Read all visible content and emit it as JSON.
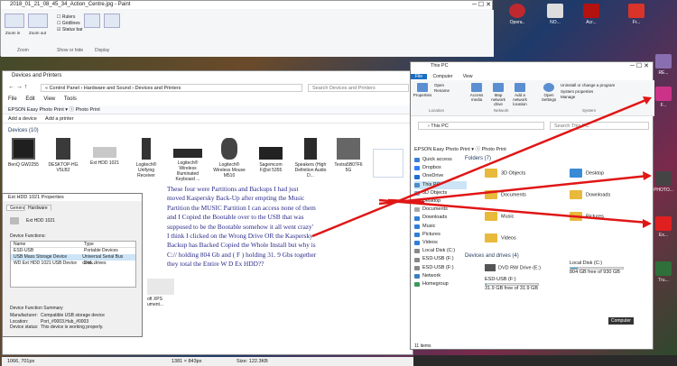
{
  "paint": {
    "title": "2018_01_21_08_45_34_Action_Centre.jpg - Paint",
    "checks": [
      "Rulers",
      "Gridlines",
      "Status bar"
    ],
    "buttons": [
      "Zoom in",
      "Zoom out",
      "100%",
      "Full screen",
      "Thumbnail"
    ],
    "groups": [
      "Zoom",
      "Show or hide",
      "Display"
    ],
    "status": {
      "coords": "1066, 701px",
      "dimensions": "1381 × 843px",
      "size": "Size: 122.3KB"
    }
  },
  "dap": {
    "title": "Devices and Printers",
    "address": "« Control Panel › Hardware and Sound › Devices and Printers",
    "search_placeholder": "Search Devices and Printers",
    "menu": [
      "File",
      "Edit",
      "View",
      "Tools"
    ],
    "app_bar": "EPSON  Easy Photo Print  ▾  ⓘ Photo Print",
    "commands": [
      "Add a device",
      "Add a printer"
    ],
    "section_title": "Devices (10)",
    "devices": [
      {
        "label": "BenQ GW2255",
        "icon": "monitor-icon"
      },
      {
        "label": "DESKTOP-HG V5LB2",
        "icon": "computer-tower-icon"
      },
      {
        "label": "Ext HDD 1021",
        "icon": "external-drive-icon"
      },
      {
        "label": "Logitech® Unifying Receiver",
        "icon": "usb-receiver-icon"
      },
      {
        "label": "Logitech® Wireless Illuminated Keyboard ...",
        "icon": "keyboard-icon"
      },
      {
        "label": "Logitech® Wireless Mouse M510",
        "icon": "mouse-icon"
      },
      {
        "label": "Sagemcom F@st 5355",
        "icon": "router-icon"
      },
      {
        "label": "Speakers (High Definition Audio D...",
        "icon": "speaker-icon"
      },
      {
        "label": "Textra5B07F6 5G",
        "icon": "hotspot-icon"
      }
    ],
    "partial_label": "oft XPS ument..."
  },
  "props": {
    "title": "Ext HDD 1021 Properties",
    "tabs": [
      "General",
      "Hardware"
    ],
    "device_name": "Ext HDD 1021",
    "functions_label": "Device Functions:",
    "columns": [
      "Name",
      "Type"
    ],
    "rows": [
      [
        "ESD-USB",
        "Portable Devices"
      ],
      [
        "USB Mass Storage Device",
        "Universal Serial Bus cont..."
      ],
      [
        "WD Ext HDD 1021 USB Device",
        "Disk drives"
      ]
    ],
    "summary_label": "Device Function Summary",
    "summary": [
      [
        "Manufacturer:",
        "Compatible USB storage device"
      ],
      [
        "Location:",
        "Port_#0003.Hub_#0003"
      ],
      [
        "Device status:",
        "This device is working properly."
      ]
    ]
  },
  "note": "These four were Partitions and Backups I had just moved Kaspersky Back-Up after empting the Music Partition the MUSIC Partition  I can access none of them and I Copied the Bootable over to the USB that was supposed to be the Bootable somehow it all went crazy' I think I clicked on the Wrong Drive OR the Kaspersky  Backup has Backed Copied the Whole  Install but why is C:// holding 804 Gb and ( F ) holding 31. 9 Gbs together they total the Entire W D Ex HDD??",
  "pc": {
    "title": "This PC",
    "tabs": [
      "File",
      "Computer",
      "View"
    ],
    "ribbon": [
      "Properties",
      "Open",
      "Rename",
      "Access media",
      "Map network drive",
      "Add a network location",
      "Open Settings",
      "Uninstall or change a program",
      "System properties",
      "Manage"
    ],
    "ribbon_groups": [
      "Location",
      "Network",
      "System"
    ],
    "address": "› This PC",
    "search_placeholder": "Search This PC",
    "app_bar": "EPSON  Easy Photo Print  ▾  ⓘ Photo Print",
    "nav": [
      "Quick access",
      "Dropbox",
      "OneDrive",
      "This PC",
      "3D Objects",
      "Desktop",
      "Documents",
      "Downloads",
      "Music",
      "Pictures",
      "Videos",
      "Local Disk (C:)",
      "ESD-USB (F:)",
      "ESD-USB (F:)",
      "Network",
      "Homegroup"
    ],
    "folders_title": "Folders (7)",
    "folders": [
      "3D Objects",
      "Desktop",
      "Documents",
      "Downloads",
      "Music",
      "Pictures",
      "Videos"
    ],
    "drives_title": "Devices and drives (4)",
    "drives": [
      {
        "name": "DVD RW Drive (E:)",
        "detail": "",
        "fill": 0
      },
      {
        "name": "Local Disk (C:)",
        "detail": "804 GB free of 930 GB",
        "fill": 0.14
      },
      {
        "name": "ESD-USB (F:)",
        "detail": "31.9 GB free of 31.9 GB",
        "fill": 0.01
      }
    ],
    "status": "11 items",
    "computer_label": "Computer"
  },
  "desktop": {
    "icons": [
      "Opera..",
      "NO...",
      "Acr...",
      "Fr...",
      "Ch...",
      "RE...",
      "F...",
      "PHOTO...",
      "RE...",
      "Ex...",
      "Tru..."
    ]
  },
  "colors": {
    "arrow": "#e01616",
    "note_text": "#2a2a8a",
    "file_tab": "#1a6fc4"
  }
}
